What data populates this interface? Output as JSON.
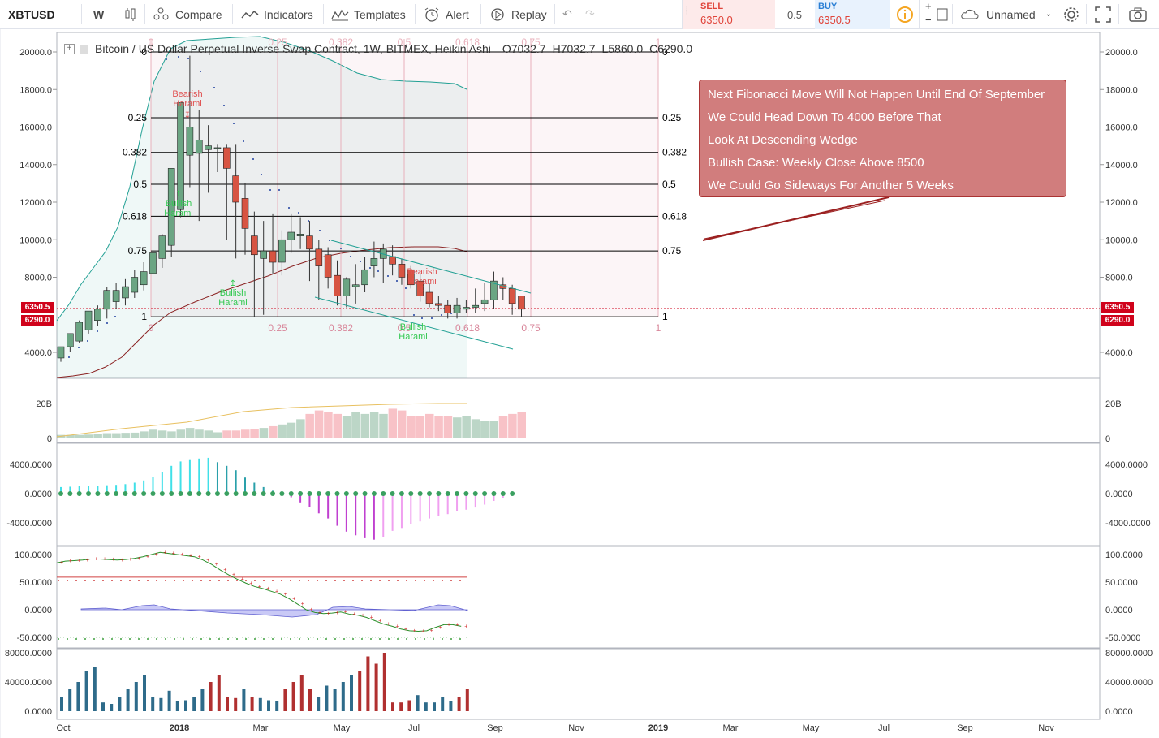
{
  "toolbar": {
    "symbol": "XBTUSD",
    "interval": "W",
    "compare": "Compare",
    "indicators": "Indicators",
    "templates": "Templates",
    "alert": "Alert",
    "replay": "Replay",
    "sell_label": "SELL",
    "sell_price": "6350.0",
    "spread": "0.5",
    "buy_label": "BUY",
    "buy_price": "6350.5",
    "layout_name": "Unnamed",
    "plus": "+",
    "minus": "−",
    "icons": [
      "bar-style-icon",
      "compare-icon",
      "indicators-icon",
      "templates-icon",
      "alert-icon",
      "replay-icon",
      "undo-icon",
      "redo-icon",
      "info-icon",
      "layout-icon",
      "cloud-icon",
      "settings-icon",
      "fullscreen-icon",
      "camera-icon"
    ]
  },
  "legend": {
    "title": "Bitcoin / US Dollar Perpetual Inverse Swap Contract, 1W, BITMEX, Heikin Ashi",
    "open": "O7032.7",
    "high": "H7032.7",
    "low": "L5860.0",
    "close": "C6290.0"
  },
  "price_badges": {
    "current": "6350.5",
    "close": "6290.0"
  },
  "note": {
    "lines": [
      "Next Fibonacci Move Will Not Happen Until End Of September",
      "We Could Head Down To 4000 Before That",
      "Look At Descending Wedge",
      "Bullish Case: Weekly Close Above 8500",
      "We Could Go Sideways For Another 5 Weeks"
    ]
  },
  "patterns": {
    "bearish_harami": "Bearish\nHarami",
    "bullish_harami": "Bullish\nHarami"
  },
  "colors": {
    "up": "#53b987",
    "down": "#eb4d5c",
    "up_candle": "#6ba583",
    "down_candle": "#d75442",
    "fib_line": "#000000",
    "note_bg": "#c45858",
    "teal": "#22a094",
    "macd_up": "#26c6da",
    "macd_down": "#c94fd6",
    "vol_blue": "#2e6b8a",
    "vol_red": "#b03030"
  },
  "chart_data": {
    "type": "candlestick",
    "title": "Bitcoin / US Dollar Perpetual Inverse Swap Contract, 1W, BITMEX, Heikin Ashi",
    "x_labels": [
      "Oct",
      "2018",
      "Mar",
      "May",
      "Jul",
      "Sep",
      "Nov",
      "2019",
      "Mar",
      "May",
      "Jul",
      "Sep",
      "Nov"
    ],
    "price_axis": [
      "20000.0",
      "18000.0",
      "16000.0",
      "14000.0",
      "12000.0",
      "10000.0",
      "8000.0",
      "4000.0"
    ],
    "price_ylim": [
      3000,
      21000
    ],
    "fib_levels": [
      {
        "level": "0",
        "price": 20000
      },
      {
        "level": "0.25",
        "price": 16500
      },
      {
        "level": "0.382",
        "price": 14650
      },
      {
        "level": "0.5",
        "price": 12950
      },
      {
        "level": "0.618",
        "price": 11250
      },
      {
        "level": "0.75",
        "price": 9400
      },
      {
        "level": "1",
        "price": 5900
      }
    ],
    "fib_time_labels": [
      "0",
      "0.25",
      "0.382",
      "0.5",
      "0.618",
      "0.75",
      "1"
    ],
    "candles": [
      [
        3700,
        4300,
        3500,
        4300
      ],
      [
        4300,
        5000,
        4000,
        5000
      ],
      [
        4600,
        5700,
        4500,
        5600
      ],
      [
        5200,
        6200,
        5000,
        6200
      ],
      [
        5700,
        6500,
        5400,
        6300
      ],
      [
        6300,
        7500,
        5800,
        7300
      ],
      [
        6700,
        7700,
        6300,
        7300
      ],
      [
        6900,
        7900,
        6500,
        7500
      ],
      [
        7200,
        8400,
        6900,
        8000
      ],
      [
        7600,
        8800,
        7300,
        8300
      ],
      [
        8200,
        9300,
        7500,
        9300
      ],
      [
        9000,
        10300,
        8500,
        10200
      ],
      [
        9700,
        13500,
        9100,
        13800
      ],
      [
        11600,
        17200,
        11200,
        17300
      ],
      [
        14500,
        19800,
        12800,
        16000
      ],
      [
        14600,
        16900,
        11000,
        15300
      ],
      [
        14800,
        16100,
        12500,
        15000
      ],
      [
        14900,
        15100,
        13600,
        14900
      ],
      [
        14900,
        15100,
        10000,
        13800
      ],
      [
        13400,
        15100,
        9000,
        12000
      ],
      [
        12200,
        13000,
        9200,
        10600
      ],
      [
        10200,
        11500,
        5900,
        9200
      ],
      [
        9000,
        11000,
        6000,
        9400
      ],
      [
        9400,
        11400,
        8200,
        8800
      ],
      [
        8800,
        10500,
        8100,
        10000
      ],
      [
        10000,
        11400,
        9300,
        10400
      ],
      [
        10200,
        11200,
        9500,
        10300
      ],
      [
        10200,
        11000,
        7800,
        9500
      ],
      [
        9500,
        10000,
        6800,
        8600
      ],
      [
        9200,
        9600,
        7400,
        8000
      ],
      [
        8100,
        8900,
        6500,
        7000
      ],
      [
        7000,
        8000,
        6400,
        7900
      ],
      [
        7500,
        8700,
        6600,
        7600
      ],
      [
        7600,
        9100,
        7200,
        8400
      ],
      [
        8600,
        9900,
        8000,
        9000
      ],
      [
        9000,
        9800,
        7700,
        9500
      ],
      [
        9100,
        9700,
        8100,
        8700
      ],
      [
        8700,
        9000,
        7600,
        8000
      ],
      [
        8400,
        8600,
        7400,
        7600
      ],
      [
        7800,
        8200,
        6700,
        7000
      ],
      [
        7200,
        7700,
        6400,
        6600
      ],
      [
        6600,
        7000,
        6200,
        6500
      ],
      [
        6500,
        6800,
        5800,
        6100
      ],
      [
        6100,
        6900,
        5800,
        6500
      ],
      [
        6300,
        6800,
        6100,
        6400
      ],
      [
        6400,
        7400,
        6100,
        6500
      ],
      [
        6600,
        7700,
        6200,
        6800
      ],
      [
        6800,
        8300,
        6300,
        7800
      ],
      [
        7600,
        8000,
        6800,
        7400
      ],
      [
        7400,
        7600,
        6000,
        6600
      ],
      [
        7000,
        7000,
        5900,
        6300
      ]
    ],
    "volume_axis": [
      "20B",
      "0"
    ],
    "volume": [
      2,
      2,
      2,
      2.2,
      2.5,
      3,
      3,
      3.2,
      3.3,
      4,
      5,
      4.5,
      4,
      5,
      6,
      5,
      4.5,
      3.5,
      4.5,
      4.5,
      5,
      5.5,
      6,
      7,
      8,
      9,
      11,
      14,
      16,
      15,
      14,
      13,
      15,
      14,
      15,
      14,
      17,
      16,
      13,
      13,
      14,
      13,
      13,
      12,
      13,
      11,
      10,
      10,
      13,
      14,
      15,
      14,
      14,
      17,
      15
    ],
    "volume_ma_label": "",
    "macd_axis": [
      "4000.0000",
      "0.0000",
      "-4000.0000"
    ],
    "macd": [
      900,
      950,
      1000,
      1050,
      1100,
      1150,
      1200,
      1300,
      1500,
      1800,
      2300,
      3000,
      3800,
      4400,
      4700,
      4800,
      4900,
      4300,
      3800,
      3200,
      2200,
      1500,
      900,
      400,
      -100,
      -500,
      -1200,
      -1800,
      -2700,
      -3400,
      -4400,
      -5200,
      -5700,
      -6100,
      -6300,
      -5900,
      -5100,
      -4700,
      -4200,
      -3800,
      -3400,
      -3100,
      -2800,
      -2400,
      -2200,
      -1900,
      -1500,
      -1000,
      -600,
      -300
    ],
    "rsi_axis": [
      "100.0000",
      "50.0000",
      "0.0000",
      "-50.0000"
    ],
    "rsi": [
      85,
      88,
      89,
      90,
      92,
      92,
      91,
      90,
      91,
      93,
      96,
      100,
      104,
      102,
      100,
      98,
      96,
      90,
      82,
      72,
      63,
      55,
      48,
      42,
      38,
      33,
      28,
      20,
      10,
      0,
      -5,
      -7,
      -6,
      -4,
      -8,
      -10,
      -14,
      -20,
      -26,
      -30,
      -35,
      -38,
      -39,
      -38,
      -32,
      -27,
      -27,
      -30
    ],
    "vol2_axis": [
      "80000.0000",
      "40000.0000",
      "0.0000"
    ],
    "vol2": [
      20,
      30,
      40,
      55,
      60,
      12,
      10,
      20,
      30,
      40,
      50,
      20,
      18,
      28,
      14,
      15,
      20,
      30,
      40,
      50,
      20,
      18,
      30,
      20,
      18,
      15,
      14,
      30,
      40,
      50,
      30,
      20,
      35,
      30,
      40,
      50,
      55,
      75,
      65,
      80,
      12,
      12,
      15,
      22,
      12,
      12,
      20,
      14,
      20,
      30
    ]
  }
}
